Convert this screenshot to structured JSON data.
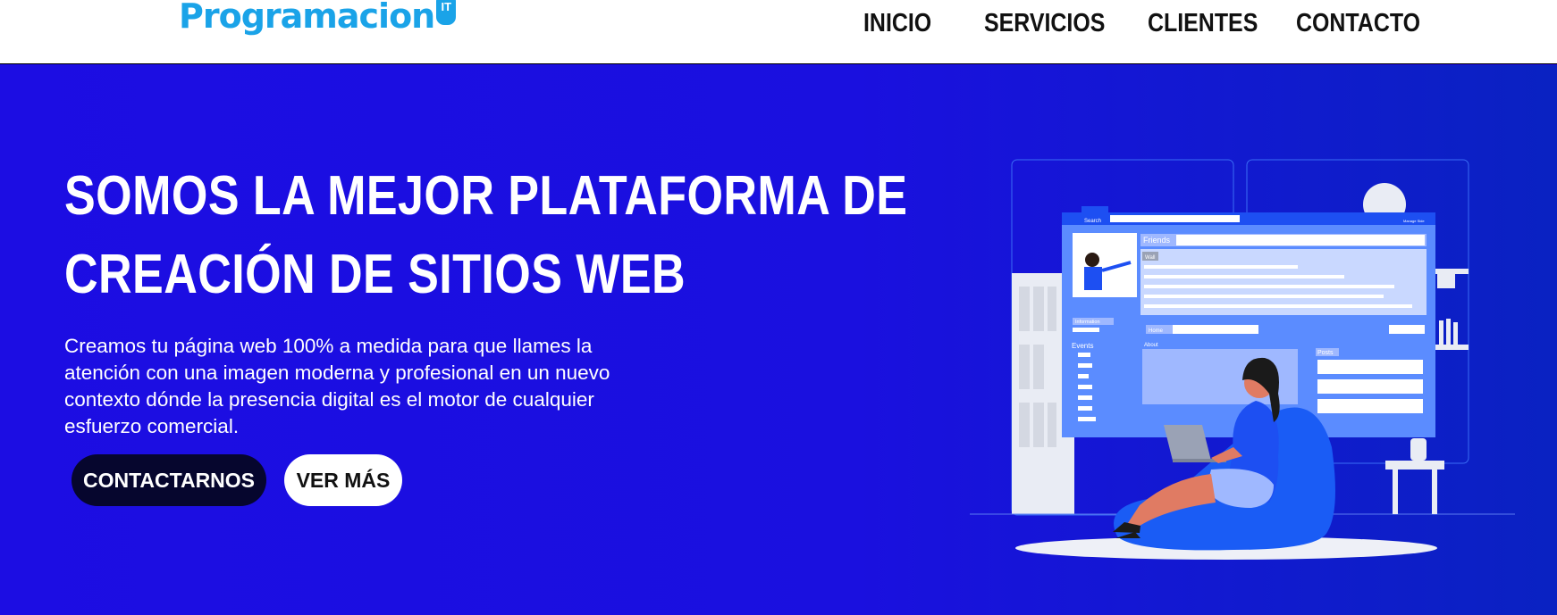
{
  "header": {
    "logo_text": "Programacion",
    "logo_badge": "IT",
    "nav": [
      {
        "label": "INICIO"
      },
      {
        "label": "SERVICIOS"
      },
      {
        "label": "CLIENTES"
      },
      {
        "label": "CONTACTO"
      }
    ]
  },
  "hero": {
    "headline_line1": "SOMOS LA MEJOR PLATAFORMA DE",
    "headline_line2": "CREACIÓN DE SITIOS WEB",
    "description": "Creamos tu página web 100% a medida para que llames la atención con una imagen moderna y profesional en un nuevo contexto dónde la presencia digital es el motor de cualquier esfuerzo comercial.",
    "primary_button": "CONTACTARNOS",
    "secondary_button": "VER MÁS"
  },
  "illustration": {
    "search_label": "Search",
    "manage_label": "Manage Side",
    "friends_label": "Friends",
    "wall_label": "Wall",
    "information_label": "Information",
    "home_label": "Home",
    "events_label": "Events",
    "about_label": "About",
    "posts_label": "Posts"
  },
  "colors": {
    "brand": "#1aa3e8",
    "hero_bg": "#1b0fe0",
    "button_dark": "#06062e",
    "button_light": "#ffffff"
  }
}
